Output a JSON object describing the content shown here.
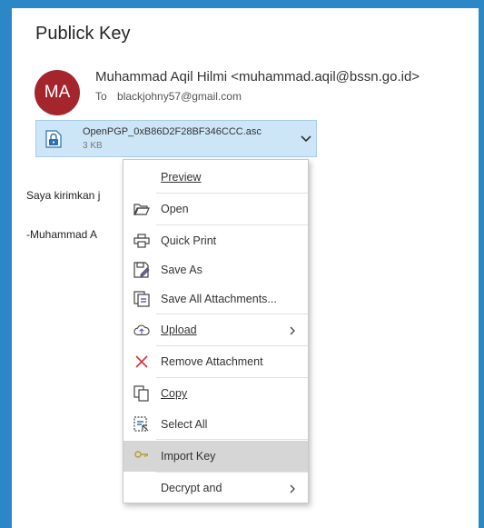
{
  "message": {
    "subject": "Publick Key",
    "avatar_initials": "MA",
    "avatar_color": "#a4262c",
    "sender": "Muhammad Aqil Hilmi <muhammad.aqil@bssn.go.id>",
    "to_label": "To",
    "to_address": "blackjohny57@gmail.com",
    "body_line1": "Saya kirimkan j",
    "body_line2": "-Muhammad A"
  },
  "attachment": {
    "name": "OpenPGP_0xB86D2F28BF346CCC.asc",
    "size": "3 KB",
    "icon": "lock-file-icon",
    "background": "#cde6f7"
  },
  "context_menu": {
    "highlight_color": "#d6d6d6",
    "items": [
      {
        "label": "Preview",
        "icon": "none",
        "submenu": false
      },
      {
        "label": "Open",
        "icon": "folder-open-icon",
        "submenu": false
      },
      {
        "label": "Quick Print",
        "icon": "printer-icon",
        "submenu": false
      },
      {
        "label": "Save As",
        "icon": "save-as-icon",
        "submenu": false
      },
      {
        "label": "Save All Attachments...",
        "icon": "save-all-icon",
        "submenu": false
      },
      {
        "label": "Upload",
        "icon": "upload-cloud-icon",
        "submenu": true
      },
      {
        "label": "Remove Attachment",
        "icon": "remove-x-icon",
        "submenu": false
      },
      {
        "label": "Copy",
        "icon": "copy-icon",
        "submenu": false
      },
      {
        "label": "Select All",
        "icon": "select-all-icon",
        "submenu": false
      },
      {
        "label": "Import Key",
        "icon": "import-key-icon",
        "submenu": false,
        "highlighted": true
      },
      {
        "label": "Decrypt and",
        "icon": "none",
        "submenu": true
      }
    ]
  }
}
